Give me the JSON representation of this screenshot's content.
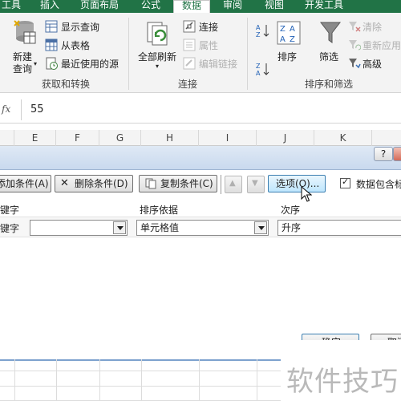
{
  "ribbon_tabs": {
    "tools": "工具",
    "insert": "插入",
    "page_layout": "页面布局",
    "formulas": "公式",
    "data": "数据",
    "review": "审阅",
    "view": "视图",
    "developer": "开发工具"
  },
  "get_transform": {
    "new_query": "新建",
    "new_query_line2": "查询",
    "show_queries": "显示查询",
    "from_table": "从表格",
    "recent_sources": "最近使用的源",
    "group_label": "获取和转换"
  },
  "connections": {
    "refresh_all": "全部刷新",
    "connections": "连接",
    "properties": "属性",
    "edit_links": "编辑链接",
    "group_label": "连接"
  },
  "sort_filter": {
    "sort": "排序",
    "filter": "筛选",
    "clear": "清除",
    "reapply": "重新应用",
    "advanced": "高级",
    "group_label": "排序和筛选"
  },
  "formula_bar": {
    "fx": "fx",
    "value": "55"
  },
  "columns": [
    "E",
    "F",
    "G",
    "H",
    "I",
    "J",
    "K"
  ],
  "sort_dialog": {
    "help": "?",
    "add_level": "添加条件(A)",
    "delete_level": "删除条件(D)",
    "copy_level": "复制条件(C)",
    "options": "选项(O)...",
    "has_headers": "数据包含标",
    "col_header_column": "关键字",
    "col_header_sort_on": "排序依据",
    "col_header_order": "次序",
    "key_value": "",
    "sort_on_value": "单元格值",
    "order_value": "升序",
    "ok": "确定",
    "cancel": "取消"
  },
  "watermark": "软件技巧",
  "colors": {
    "ribbon_green": "#217346",
    "dialog_title": "#c9d9ee"
  }
}
